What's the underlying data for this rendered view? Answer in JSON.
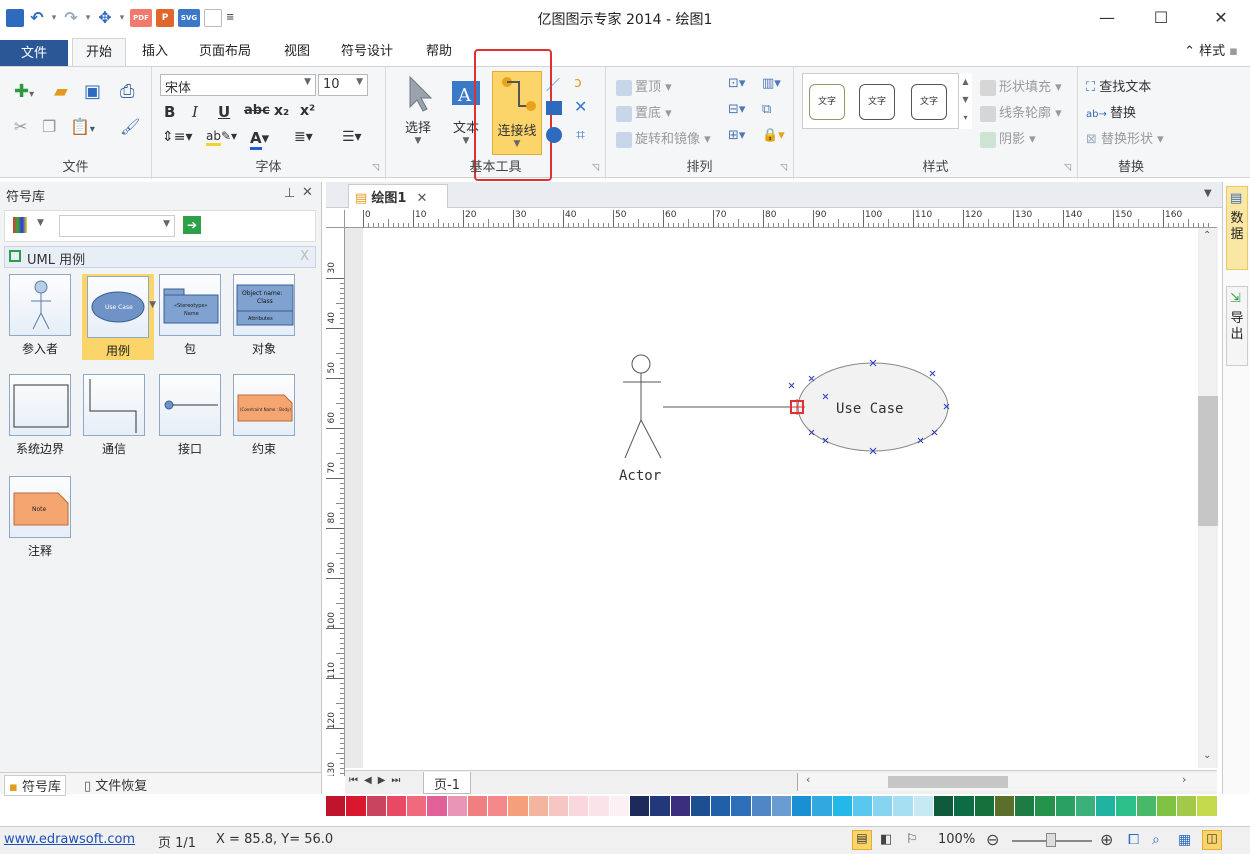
{
  "app": {
    "title": "亿图图示专家 2014 - 绘图1"
  },
  "qat": {
    "pdf": "PDF",
    "ppt": "P",
    "svg": "SVG"
  },
  "tabs": [
    "文件",
    "开始",
    "插入",
    "页面布局",
    "视图",
    "符号设计",
    "帮助"
  ],
  "style_menu": "样式",
  "ribbon": {
    "file_group_label": "文件",
    "font": {
      "name": "宋体",
      "size": "10",
      "label": "字体"
    },
    "tools": {
      "select": "选择",
      "text": "文本",
      "connector": "连接线",
      "label": "基本工具"
    },
    "arrange": {
      "top": "置顶",
      "bottom": "置底",
      "rotate": "旋转和镜像",
      "label": "排列"
    },
    "styles": {
      "s1": "文字",
      "s2": "文字",
      "s3": "文字",
      "fill": "形状填充",
      "line": "线条轮廓",
      "shadow": "阴影",
      "label": "样式"
    },
    "replace": {
      "find": "查找文本",
      "replace": "替换",
      "replace_shape": "替换形状",
      "label": "替换"
    }
  },
  "left_panel": {
    "title": "符号库",
    "library": "UML 用例",
    "symbols": [
      "参入者",
      "用例",
      "包",
      "对象",
      "系统边界",
      "通信",
      "接口",
      "约束",
      "注释"
    ],
    "thumb_text": {
      "usecase": "Use Case",
      "pkg1": "«Stereotype»",
      "pkg2": "Name",
      "obj1": "Object name:",
      "obj2": "Class",
      "obj3": "Attributes",
      "constraint": "(Constraint Name : Body)",
      "note": "Note"
    },
    "bottom_tabs": [
      "符号库",
      "文件恢复"
    ]
  },
  "document": {
    "tab": "绘图1",
    "page": "页-1"
  },
  "ruler_h": [
    "0",
    "10",
    "20",
    "30",
    "40",
    "50",
    "60",
    "70",
    "80",
    "90",
    "100",
    "110",
    "120",
    "130",
    "140",
    "150",
    "160"
  ],
  "ruler_v": [
    "30",
    "40",
    "50",
    "60",
    "70",
    "80",
    "90",
    "100",
    "110",
    "120",
    "130"
  ],
  "canvas": {
    "actor_label": "Actor",
    "usecase_label": "Use Case"
  },
  "side_tabs": [
    "数据",
    "导出"
  ],
  "status": {
    "link": "www.edrawsoft.com",
    "page": "页 1/1",
    "coords": "X = 85.8, Y= 56.0",
    "zoom": "100%"
  },
  "palette": [
    "#c0142c",
    "#d9182f",
    "#c8445f",
    "#e84a63",
    "#f06a7e",
    "#e06097",
    "#e995b6",
    "#f08080",
    "#f4888a",
    "#f5a07a",
    "#f3b4a0",
    "#f6c7c2",
    "#f9d7dd",
    "#fbe3ea",
    "#fdf0f4",
    "#1c2b5a",
    "#23387a",
    "#3b2e7d",
    "#1d4e8f",
    "#2060a8",
    "#2d6fb8",
    "#4f86c6",
    "#6a9bd1",
    "#1b8fd3",
    "#32a8e0",
    "#22b8e8",
    "#59c7ee",
    "#86d4f0",
    "#a7dff2",
    "#c6e9f5",
    "#0e5a3a",
    "#0d6b45",
    "#15703c",
    "#5b6f2a",
    "#1e7b43",
    "#24924a",
    "#2aa063",
    "#3bb07a",
    "#20b4a0",
    "#2dbf8a",
    "#48b968",
    "#7fc241",
    "#a3c94a",
    "#c4d94b"
  ]
}
